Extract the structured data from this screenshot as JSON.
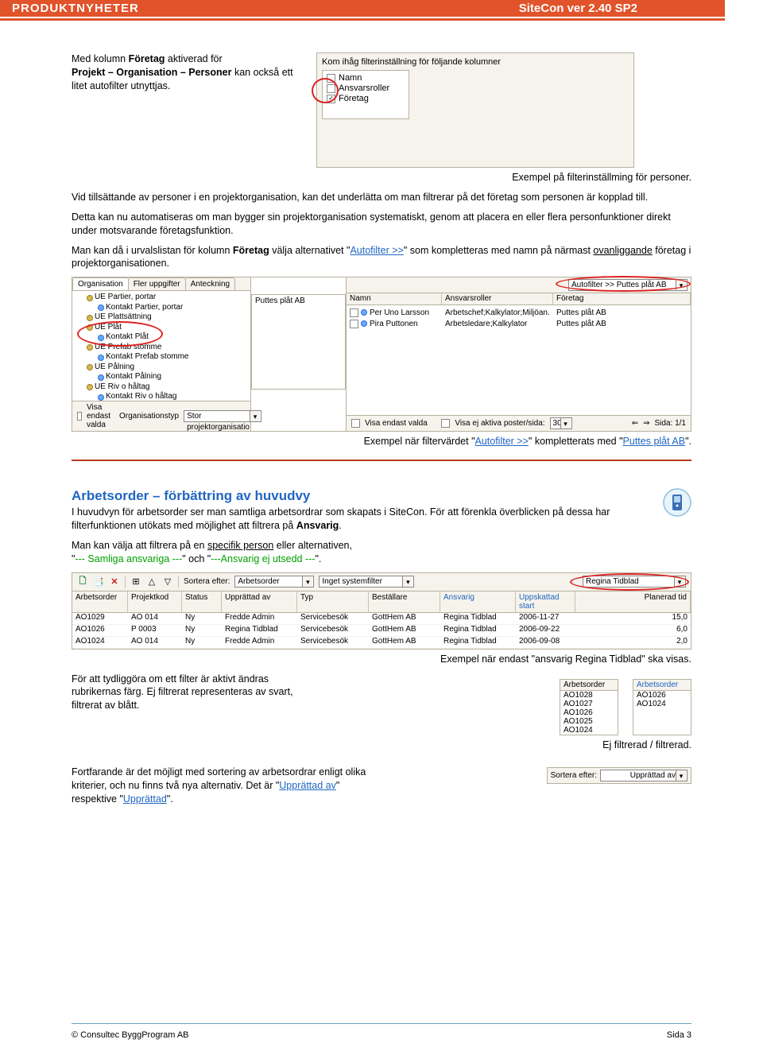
{
  "header": {
    "left": "PRODUKTNYHETER",
    "right": "SiteCon ver 2.40 SP2"
  },
  "intro": {
    "p1_pre": "Med kolumn ",
    "p1_bold": "Företag",
    "p1_post": " aktiverad för",
    "p2_bold": "Projekt – Organisation – Personer",
    "p2_post": " kan också ett litet autofilter utnyttjas.",
    "shot1_title": "Kom ihåg filterinställning för följande kolumner",
    "shot1_items": [
      "Namn",
      "Ansvarsroller",
      "Företag"
    ],
    "caption1": "Exempel på filterinställming för personer.",
    "p3": "Vid tillsättande av personer i en projektorganisation, kan det underlätta om man filtrerar på det företag som personen är kopplad till.",
    "p4": "Detta kan nu automatiseras om man bygger sin projektorganisation systematiskt, genom att placera en eller flera personfunktioner direkt under motsvarande företagsfunktion.",
    "p5_pre": "Man kan då i urvalslistan för kolumn ",
    "p5_b1": "Företag",
    "p5_mid": " välja alternativet ",
    "p5_link1": "Autofilter >>",
    "p5_mid2": " som kompletteras med namn på närmast ",
    "p5_u": "ovanliggande",
    "p5_post": " företag i projektorganisationen."
  },
  "shot2": {
    "tabs": [
      "Organisation",
      "Fler uppgifter",
      "Anteckning"
    ],
    "tree": [
      "UE Partier, portar",
      "Kontakt Partier, portar",
      "UE Plattsättning",
      "UE Plåt",
      "Kontakt Plåt",
      "UE Prefab stomme",
      "Kontakt Prefab stomme",
      "UE Pålning",
      "Kontakt Pålning",
      "UE Riv o håltag",
      "Kontakt Riv o håltag"
    ],
    "mid_label": "Puttes plåt AB",
    "filter_label": "Autofilter >> Puttes plåt AB",
    "cols": {
      "name": "Namn",
      "roles": "Ansvarsroller",
      "company": "Företag"
    },
    "rows": [
      {
        "name": "Per Uno Larsson",
        "roles": "Arbetschef;Kalkylator;Miljöan.",
        "company": "Puttes plåt AB"
      },
      {
        "name": "Pira Puttonen",
        "roles": "Arbetsledare;Kalkylator",
        "company": "Puttes plåt AB"
      }
    ],
    "bottom": {
      "visa_left": "Visa endast valda",
      "orgtype_label": "Organisationstyp",
      "orgtype_val": "Stor projektorganisatio",
      "visa_mid": "Visa endast valda",
      "visa_right": "Visa ej aktiva  poster/sida:",
      "posts": "30",
      "page": "Sida:  1/1"
    },
    "caption_pre": "Exempel när filtervärdet ",
    "caption_l1": "Autofilter >>",
    "caption_mid": " kompletterats med ",
    "caption_l2": "Puttes plåt AB"
  },
  "section2": {
    "title": "Arbetsorder – förbättring av huvudvy",
    "p1": "I huvudvyn för arbetsorder ser man samtliga arbetsordrar som skapats i SiteCon. För att förenkla överblicken på dessa har filterfunktionen utökats med möjlighet att filtrera på ",
    "p1_b": "Ansvarig",
    "p2_pre": "Man kan välja att filtrera på en ",
    "p2_u": "specifik person",
    "p2_mid": " eller alternativen,",
    "p2_opt1": "--- Samliga ansvariga ---",
    "p2_join": " och ",
    "p2_opt2": "---Ansvarig ej utsedd ---",
    "caption_right": "Exempel när endast \"ansvarig Regina Tidblad\" ska visas.",
    "p3": "För att tydliggöra om ett filter är aktivt ändras rubrikernas färg. Ej filtrerat representeras av svart, filtrerat av blått.",
    "lists": {
      "left_head": "Arbetsorder",
      "left_items": [
        "AO1028",
        "AO1027",
        "AO1026",
        "AO1025",
        "AO1024"
      ],
      "right_head": "Arbetsorder",
      "right_items": [
        "AO1026",
        "AO1024"
      ]
    },
    "lists_caption_left": "Ej filtrerad",
    "lists_caption_sep": "   /   ",
    "lists_caption_right": "filtrerad.",
    "p4_pre": "Fortfarande är det möjligt med sortering av arbetsordrar enligt olika kriterier, och nu finns två nya alternativ. Det är ",
    "p4_l1": "Upprättad av",
    "p4_mid": " respektive ",
    "p4_l2": "Upprättad",
    "sort_label": "Sortera efter:",
    "sort_val": "Upprättad av"
  },
  "shot3": {
    "toolbar": {
      "sort_label": "Sortera efter:",
      "sort_val": "Arbetsorder",
      "sysfilter": "Inget systemfilter",
      "ansvarig": "Regina Tidblad"
    },
    "cols": [
      "Arbetsorder",
      "Projektkod",
      "Status",
      "Upprättad av",
      "Typ",
      "Beställare",
      "Ansvarig",
      "Uppskattad start",
      "Planerad tid"
    ],
    "rows": [
      [
        "AO1029",
        "AO 014",
        "Ny",
        "Fredde Admin",
        "Servicebesök",
        "GottHem AB",
        "Regina Tidblad",
        "2006-11-27",
        "15,0"
      ],
      [
        "AO1026",
        "P 0003",
        "Ny",
        "Regina Tidblad",
        "Servicebesök",
        "GottHem AB",
        "Regina Tidblad",
        "2006-09-22",
        "6,0"
      ],
      [
        "AO1024",
        "AO 014",
        "Ny",
        "Fredde Admin",
        "Servicebesök",
        "GottHem AB",
        "Regina Tidblad",
        "2006-09-08",
        "2,0"
      ]
    ]
  },
  "footer": {
    "left": "© Consultec ByggProgram AB",
    "right": "Sida 3"
  }
}
